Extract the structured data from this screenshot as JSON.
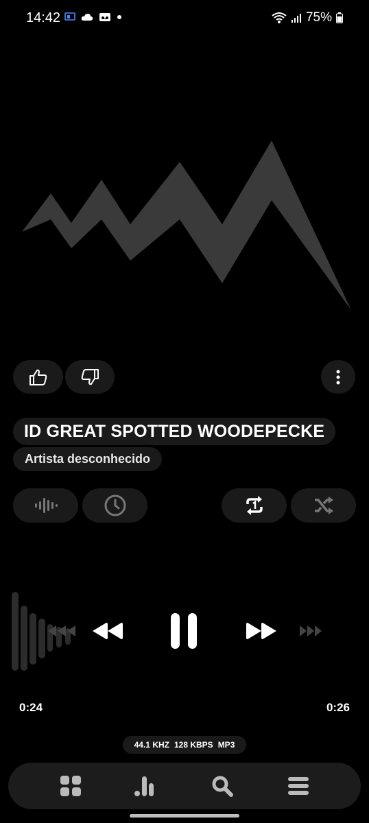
{
  "status_bar": {
    "time": "14:42",
    "battery_percent": "75%"
  },
  "track": {
    "title": "ID GREAT SPOTTED WOODEPECKE",
    "artist": "Artista desconhecido"
  },
  "playback": {
    "elapsed": "0:24",
    "remaining": "0:26",
    "state": "playing"
  },
  "format": {
    "sample_rate": "44.1 KHZ",
    "bitrate": "128 KBPS",
    "codec": "MP3"
  },
  "icons": {
    "like": "thumbs-up-icon",
    "dislike": "thumbs-down-icon",
    "more": "more-vertical-icon",
    "visualizer": "waveform-icon",
    "sleep_timer": "clock-icon",
    "repeat": "repeat-one-icon",
    "shuffle": "shuffle-icon",
    "previous": "rewind-icon",
    "pause": "pause-icon",
    "next": "fast-forward-icon",
    "nav_library": "grid-icon",
    "nav_stats": "bar-chart-icon",
    "nav_search": "search-icon",
    "nav_menu": "menu-icon"
  },
  "colors": {
    "background": "#000000",
    "pill": "#1a1a1a",
    "art_shape": "#3a3a3a",
    "text": "#ffffff"
  }
}
